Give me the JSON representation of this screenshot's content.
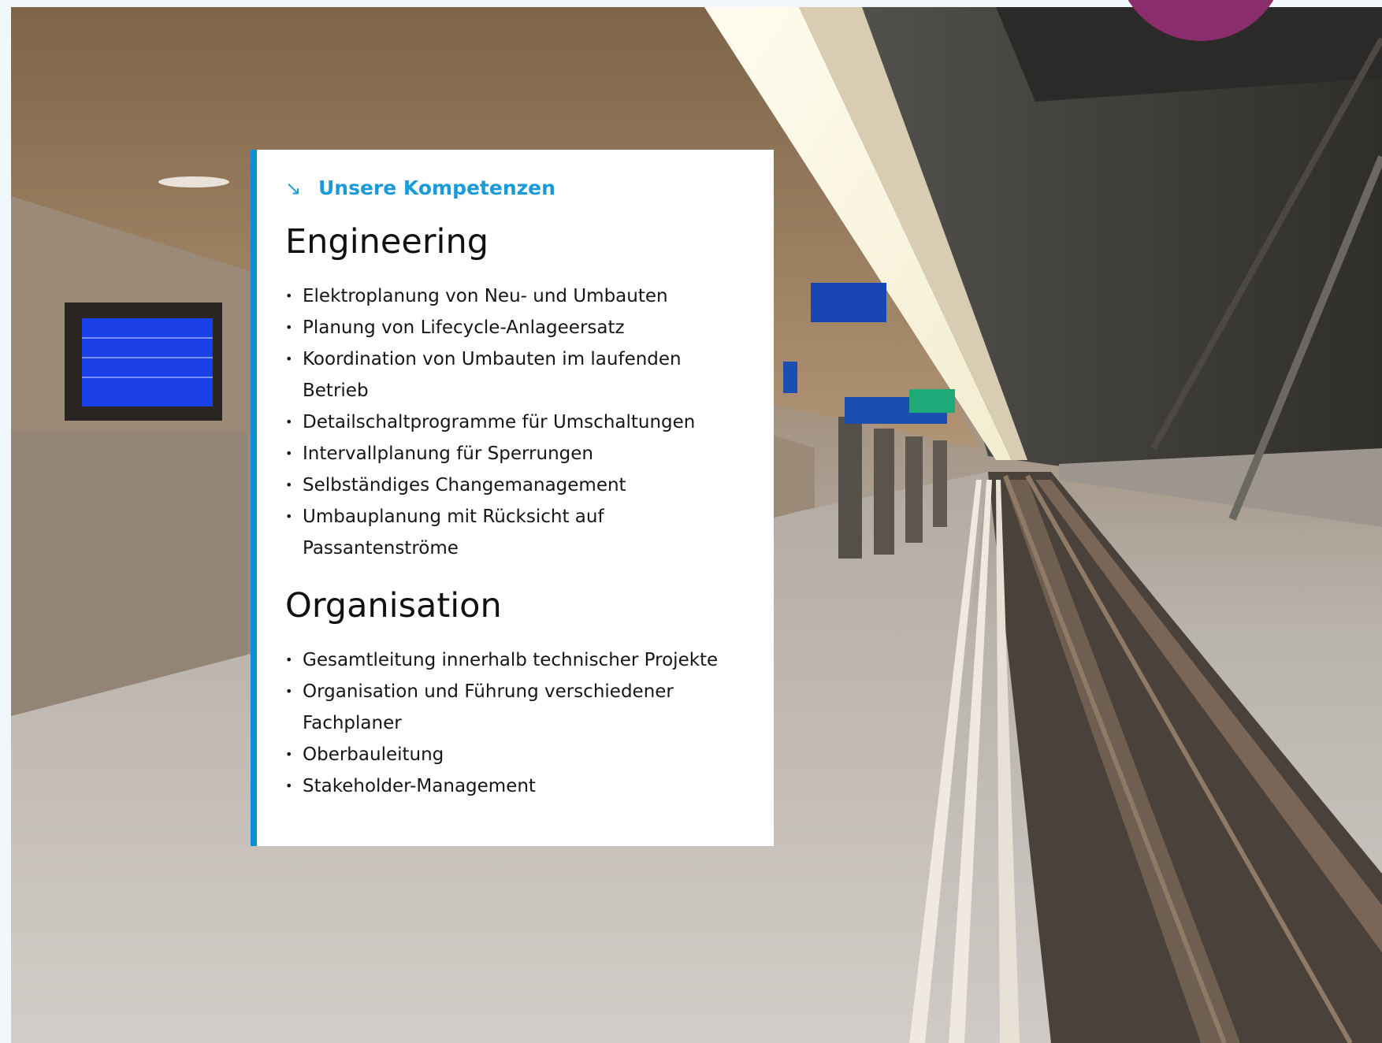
{
  "card": {
    "kicker": "Unsere Kompetenzen",
    "kicker_icon": "arrow-down-right-icon",
    "sections": [
      {
        "title": "Engineering",
        "items": [
          "Elektroplanung von Neu- und Umbauten",
          "Planung von Lifecycle-Anlageersatz",
          "Koordination von Umbauten im laufenden Betrieb",
          "Detailschaltprogramme für Umschaltungen",
          "Intervallplanung für Sperrungen",
          "Selbständiges Changemanagement",
          "Umbauplanung mit Rücksicht auf Passantenströme"
        ]
      },
      {
        "title": "Organisation",
        "items": [
          "Gesamtleitung innerhalb technischer Projekte",
          "Organisation und Führung verschiedener Fachplaner",
          "Oberbauleitung",
          "Stakeholder-Management"
        ]
      }
    ]
  },
  "colors": {
    "accent": "#0a8fd8",
    "kicker": "#1b9ad8",
    "decor_circle": "#8b2c6c"
  }
}
